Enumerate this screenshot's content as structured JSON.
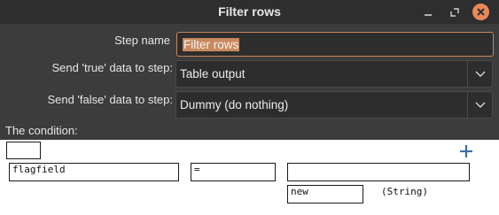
{
  "window": {
    "title": "Filter rows"
  },
  "form": {
    "step_name_label": "Step name",
    "step_name_value": "Filter rows",
    "send_true_label": "Send 'true' data to step:",
    "send_true_value": "Table output",
    "send_false_label": "Send 'false' data to step:",
    "send_false_value": "Dummy (do nothing)"
  },
  "condition": {
    "label": "The condition:",
    "negate_value": "",
    "left_field": "flagfield",
    "operator": "=",
    "right_field": "",
    "value": "new",
    "value_type": "(String)"
  },
  "colors": {
    "accent": "#e9895a",
    "selection": "#c9895d",
    "focus_border": "#c8855a"
  },
  "icons": {
    "close": "close-icon",
    "minimize": "minimize-icon",
    "maximize": "maximize-icon",
    "dropdown": "chevron-down-icon",
    "add": "plus-icon"
  }
}
